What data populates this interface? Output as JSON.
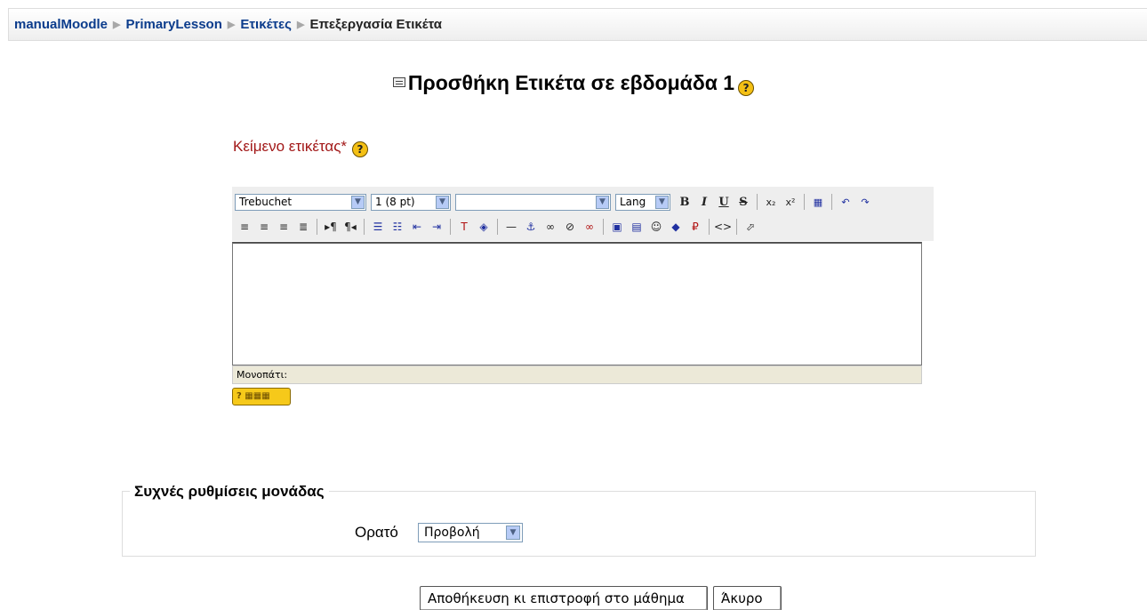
{
  "breadcrumb": {
    "items": [
      "manualMoodle",
      "PrimaryLesson",
      "Ετικέτες"
    ],
    "current": "Επεξεργασία Ετικέτα",
    "separator": "▶"
  },
  "page": {
    "title": "Προσθήκη Ετικέτα σε εβδομάδα 1",
    "help_glyph": "?"
  },
  "form": {
    "label_text": "Κείμενο ετικέτας*",
    "editor": {
      "font_family": "Trebuchet",
      "font_size": "1 (8 pt)",
      "style": "",
      "lang": "Lang",
      "path_label": "Μονοπάτι:",
      "kbd_help_glyph": "?"
    },
    "section_legend": "Συχνές ρυθμίσεις μονάδας",
    "visible_label": "Ορατό",
    "visible_value": "Προβολή"
  },
  "buttons": {
    "save": "Αποθήκευση κι επιστροφή στο μάθημα",
    "cancel": "Άκυρο"
  },
  "colors": {
    "link": "#0b3c8c",
    "required_label": "#a21818",
    "help_icon": "#f4c014"
  }
}
